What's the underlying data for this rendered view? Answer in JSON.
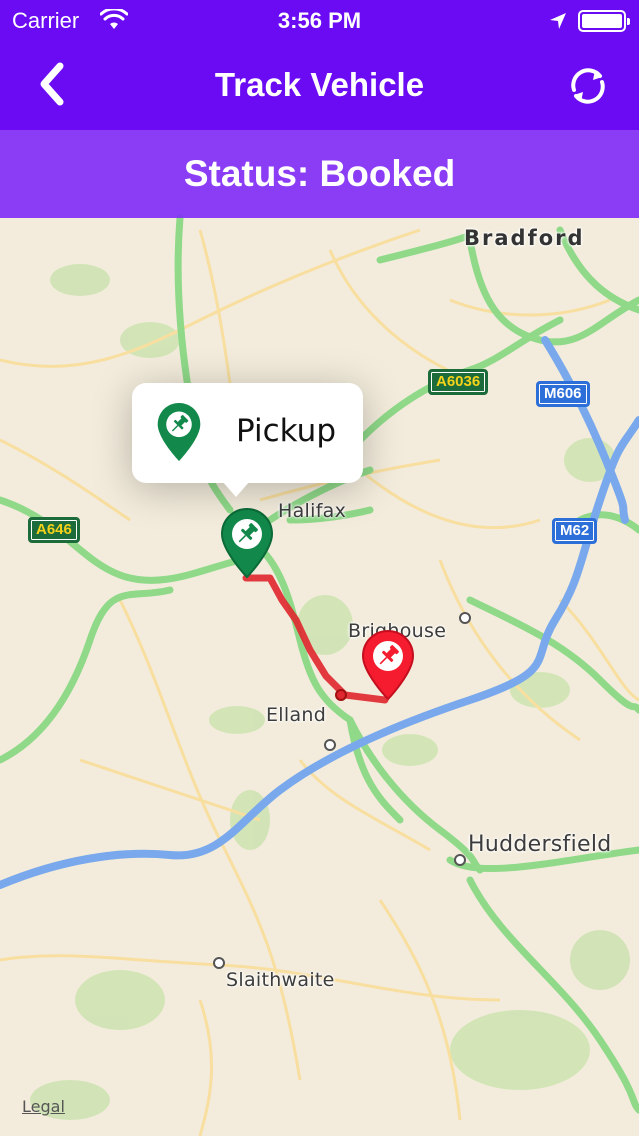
{
  "status_bar": {
    "carrier": "Carrier",
    "time": "3:56 PM"
  },
  "nav": {
    "title": "Track Vehicle"
  },
  "banner": {
    "text": "Status: Booked"
  },
  "callout": {
    "label": "Pickup"
  },
  "map": {
    "places": {
      "bradford": "Bradford",
      "halifax": "Halifax",
      "brighouse": "Brighouse",
      "elland": "Elland",
      "huddersfield": "Huddersfield",
      "slaithwaite": "Slaithwaite"
    },
    "shields": {
      "a6036": "A6036",
      "m606": "M606",
      "a646": "A646",
      "m62": "M62"
    },
    "legal": "Legal"
  },
  "colors": {
    "header": "#6a0bf3",
    "banner": "#7f2af7",
    "pickup_pin": "#12894a",
    "dropoff_pin": "#f41c2e",
    "route": "#e0262e"
  },
  "icons": {
    "back": "chevron-left-icon",
    "refresh": "refresh-icon",
    "wifi": "wifi-icon",
    "location": "location-arrow-icon",
    "battery": "battery-icon",
    "pickup_pin": "pickup-pin-icon",
    "dropoff_pin": "dropoff-pin-icon"
  }
}
